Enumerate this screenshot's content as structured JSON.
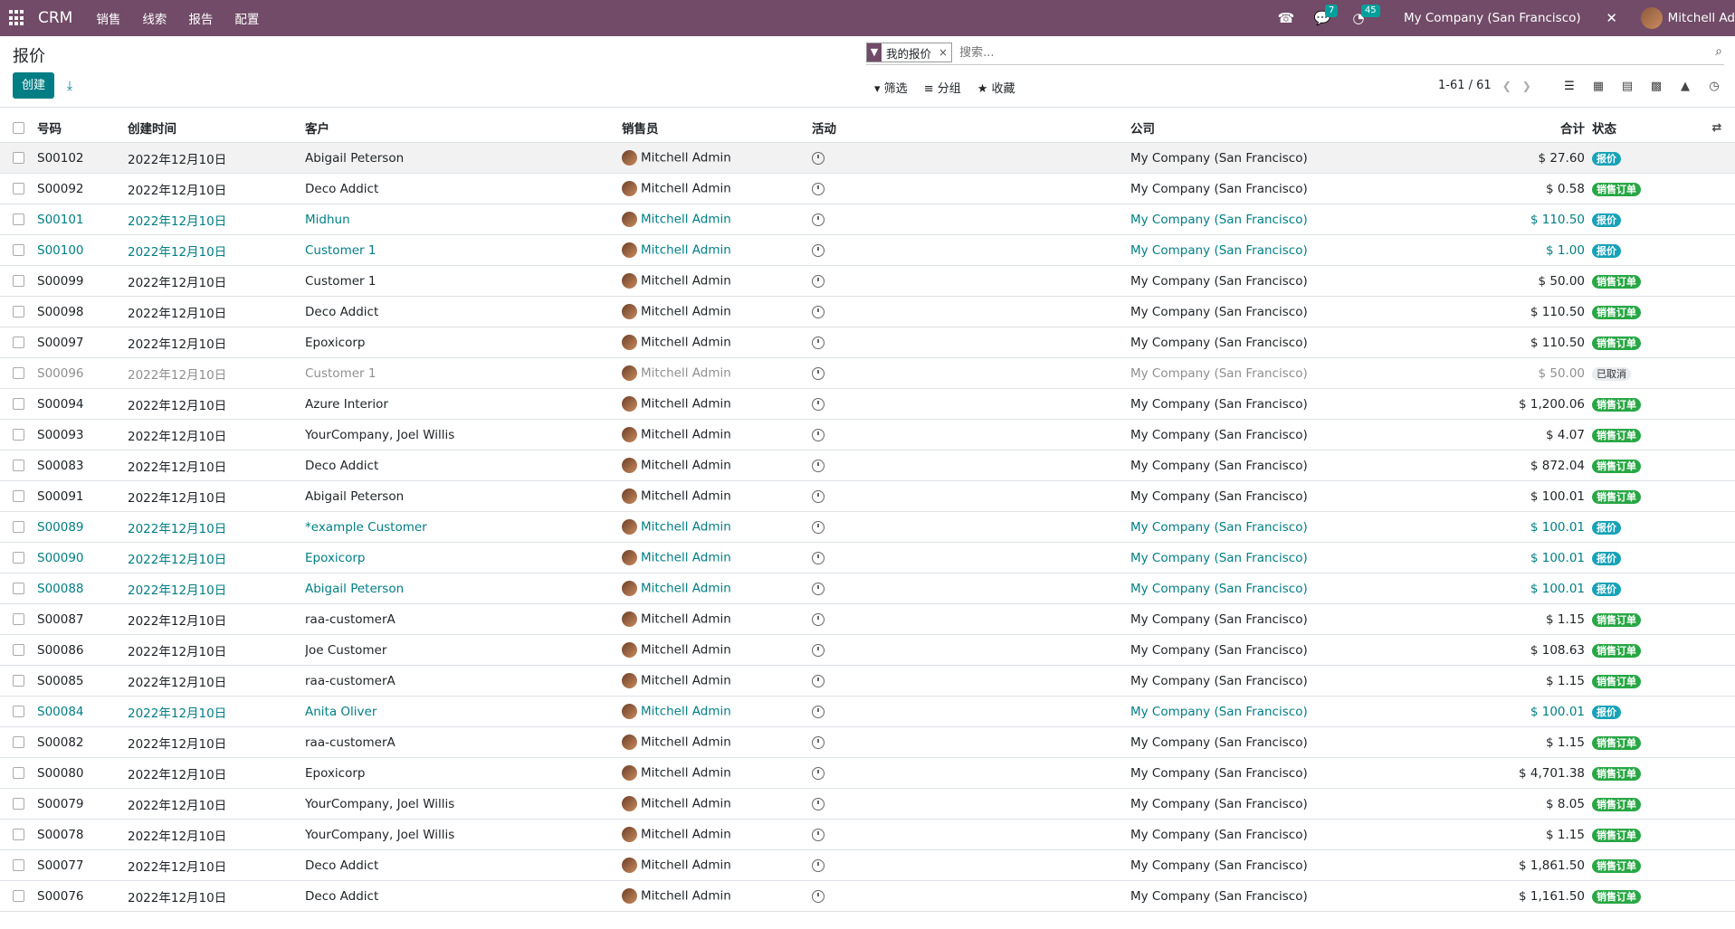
{
  "navbar": {
    "brand": "CRM",
    "menu": [
      "销售",
      "线索",
      "报告",
      "配置"
    ],
    "messages_count": "7",
    "activities_count": "45",
    "company": "My Company (San Francisco)",
    "user": "Mitchell Ad"
  },
  "page": {
    "title": "报价",
    "create_label": "创建"
  },
  "search": {
    "facet": "我的报价",
    "placeholder": "搜索..."
  },
  "filters": {
    "filter_label": "筛选",
    "group_label": "分组",
    "favorites_label": "收藏"
  },
  "pager": {
    "text": "1-61 / 61"
  },
  "table": {
    "headers": {
      "number": "号码",
      "created": "创建时间",
      "customer": "客户",
      "salesperson": "销售员",
      "activity": "活动",
      "company": "公司",
      "total": "合计",
      "status": "状态"
    },
    "rows": [
      {
        "number": "S00102",
        "date": "2022年12月10日",
        "customer": "Abigail Peterson",
        "salesperson": "Mitchell Admin",
        "company": "My Company (San Francisco)",
        "total": "$ 27.60",
        "status": "报价",
        "status_type": "quote",
        "style": "first"
      },
      {
        "number": "S00092",
        "date": "2022年12月10日",
        "customer": "Deco Addict",
        "salesperson": "Mitchell Admin",
        "company": "My Company (San Francisco)",
        "total": "$ 0.58",
        "status": "销售订单",
        "status_type": "sale",
        "style": ""
      },
      {
        "number": "S00101",
        "date": "2022年12月10日",
        "customer": "Midhun",
        "salesperson": "Mitchell Admin",
        "company": "My Company (San Francisco)",
        "total": "$ 110.50",
        "status": "报价",
        "status_type": "quote",
        "style": "highlight"
      },
      {
        "number": "S00100",
        "date": "2022年12月10日",
        "customer": "Customer 1",
        "salesperson": "Mitchell Admin",
        "company": "My Company (San Francisco)",
        "total": "$ 1.00",
        "status": "报价",
        "status_type": "quote",
        "style": "highlight"
      },
      {
        "number": "S00099",
        "date": "2022年12月10日",
        "customer": "Customer 1",
        "salesperson": "Mitchell Admin",
        "company": "My Company (San Francisco)",
        "total": "$ 50.00",
        "status": "销售订单",
        "status_type": "sale",
        "style": ""
      },
      {
        "number": "S00098",
        "date": "2022年12月10日",
        "customer": "Deco Addict",
        "salesperson": "Mitchell Admin",
        "company": "My Company (San Francisco)",
        "total": "$ 110.50",
        "status": "销售订单",
        "status_type": "sale",
        "style": ""
      },
      {
        "number": "S00097",
        "date": "2022年12月10日",
        "customer": "Epoxicorp",
        "salesperson": "Mitchell Admin",
        "company": "My Company (San Francisco)",
        "total": "$ 110.50",
        "status": "销售订单",
        "status_type": "sale",
        "style": ""
      },
      {
        "number": "S00096",
        "date": "2022年12月10日",
        "customer": "Customer 1",
        "salesperson": "Mitchell Admin",
        "company": "My Company (San Francisco)",
        "total": "$ 50.00",
        "status": "已取消",
        "status_type": "cancel",
        "style": "muted"
      },
      {
        "number": "S00094",
        "date": "2022年12月10日",
        "customer": "Azure Interior",
        "salesperson": "Mitchell Admin",
        "company": "My Company (San Francisco)",
        "total": "$ 1,200.06",
        "status": "销售订单",
        "status_type": "sale",
        "style": ""
      },
      {
        "number": "S00093",
        "date": "2022年12月10日",
        "customer": "YourCompany, Joel Willis",
        "salesperson": "Mitchell Admin",
        "company": "My Company (San Francisco)",
        "total": "$ 4.07",
        "status": "销售订单",
        "status_type": "sale",
        "style": ""
      },
      {
        "number": "S00083",
        "date": "2022年12月10日",
        "customer": "Deco Addict",
        "salesperson": "Mitchell Admin",
        "company": "My Company (San Francisco)",
        "total": "$ 872.04",
        "status": "销售订单",
        "status_type": "sale",
        "style": ""
      },
      {
        "number": "S00091",
        "date": "2022年12月10日",
        "customer": "Abigail Peterson",
        "salesperson": "Mitchell Admin",
        "company": "My Company (San Francisco)",
        "total": "$ 100.01",
        "status": "销售订单",
        "status_type": "sale",
        "style": ""
      },
      {
        "number": "S00089",
        "date": "2022年12月10日",
        "customer": "*example Customer",
        "salesperson": "Mitchell Admin",
        "company": "My Company (San Francisco)",
        "total": "$ 100.01",
        "status": "报价",
        "status_type": "quote",
        "style": "highlight"
      },
      {
        "number": "S00090",
        "date": "2022年12月10日",
        "customer": "Epoxicorp",
        "salesperson": "Mitchell Admin",
        "company": "My Company (San Francisco)",
        "total": "$ 100.01",
        "status": "报价",
        "status_type": "quote",
        "style": "highlight"
      },
      {
        "number": "S00088",
        "date": "2022年12月10日",
        "customer": "Abigail Peterson",
        "salesperson": "Mitchell Admin",
        "company": "My Company (San Francisco)",
        "total": "$ 100.01",
        "status": "报价",
        "status_type": "quote",
        "style": "highlight"
      },
      {
        "number": "S00087",
        "date": "2022年12月10日",
        "customer": "raa-customerA",
        "salesperson": "Mitchell Admin",
        "company": "My Company (San Francisco)",
        "total": "$ 1.15",
        "status": "销售订单",
        "status_type": "sale",
        "style": ""
      },
      {
        "number": "S00086",
        "date": "2022年12月10日",
        "customer": "Joe Customer",
        "salesperson": "Mitchell Admin",
        "company": "My Company (San Francisco)",
        "total": "$ 108.63",
        "status": "销售订单",
        "status_type": "sale",
        "style": ""
      },
      {
        "number": "S00085",
        "date": "2022年12月10日",
        "customer": "raa-customerA",
        "salesperson": "Mitchell Admin",
        "company": "My Company (San Francisco)",
        "total": "$ 1.15",
        "status": "销售订单",
        "status_type": "sale",
        "style": ""
      },
      {
        "number": "S00084",
        "date": "2022年12月10日",
        "customer": "Anita Oliver",
        "salesperson": "Mitchell Admin",
        "company": "My Company (San Francisco)",
        "total": "$ 100.01",
        "status": "报价",
        "status_type": "quote",
        "style": "highlight"
      },
      {
        "number": "S00082",
        "date": "2022年12月10日",
        "customer": "raa-customerA",
        "salesperson": "Mitchell Admin",
        "company": "My Company (San Francisco)",
        "total": "$ 1.15",
        "status": "销售订单",
        "status_type": "sale",
        "style": ""
      },
      {
        "number": "S00080",
        "date": "2022年12月10日",
        "customer": "Epoxicorp",
        "salesperson": "Mitchell Admin",
        "company": "My Company (San Francisco)",
        "total": "$ 4,701.38",
        "status": "销售订单",
        "status_type": "sale",
        "style": ""
      },
      {
        "number": "S00079",
        "date": "2022年12月10日",
        "customer": "YourCompany, Joel Willis",
        "salesperson": "Mitchell Admin",
        "company": "My Company (San Francisco)",
        "total": "$ 8.05",
        "status": "销售订单",
        "status_type": "sale",
        "style": ""
      },
      {
        "number": "S00078",
        "date": "2022年12月10日",
        "customer": "YourCompany, Joel Willis",
        "salesperson": "Mitchell Admin",
        "company": "My Company (San Francisco)",
        "total": "$ 1.15",
        "status": "销售订单",
        "status_type": "sale",
        "style": ""
      },
      {
        "number": "S00077",
        "date": "2022年12月10日",
        "customer": "Deco Addict",
        "salesperson": "Mitchell Admin",
        "company": "My Company (San Francisco)",
        "total": "$ 1,861.50",
        "status": "销售订单",
        "status_type": "sale",
        "style": ""
      },
      {
        "number": "S00076",
        "date": "2022年12月10日",
        "customer": "Deco Addict",
        "salesperson": "Mitchell Admin",
        "company": "My Company (San Francisco)",
        "total": "$ 1,161.50",
        "status": "销售订单",
        "status_type": "sale",
        "style": ""
      }
    ]
  }
}
